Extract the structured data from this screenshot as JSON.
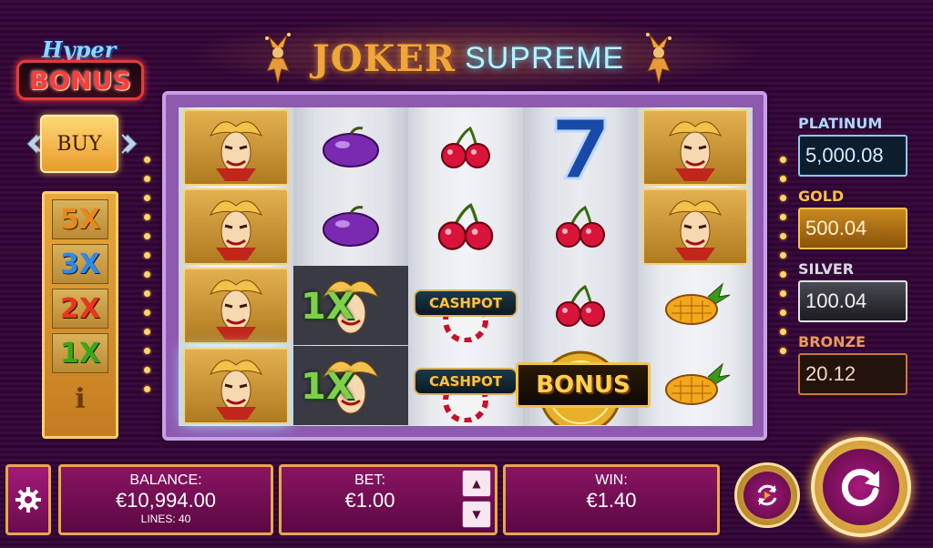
{
  "logo": {
    "part1": "JOKER",
    "part2": "SUPREME"
  },
  "hyper_bonus": {
    "line1": "Hyper",
    "line2": "BONUS"
  },
  "buy_label": "BUY",
  "multipliers": [
    {
      "label": "5X",
      "color": "#e88a1a"
    },
    {
      "label": "3X",
      "color": "#2f8ae8"
    },
    {
      "label": "2X",
      "color": "#e8381a"
    },
    {
      "label": "1X",
      "color": "#3aa81a"
    }
  ],
  "info_label": "i",
  "reels": [
    [
      "joker",
      "joker",
      "joker",
      "joker"
    ],
    [
      "plum",
      "plum",
      "joker-1x",
      "joker-1x"
    ],
    [
      "cherry",
      "cherry",
      "cashpot",
      "cashpot"
    ],
    [
      "seven",
      "cherry",
      "cherry",
      "bonus-coin"
    ],
    [
      "joker",
      "joker",
      "pineapple",
      "pineapple"
    ]
  ],
  "cashpot_label": "CASHPOT",
  "bonus_label": "BONUS",
  "mult_symbol_label": "1X",
  "jackpots": [
    {
      "label": "PLATINUM",
      "value": "5,000.08",
      "label_color": "#a9d8ff",
      "box_bg": "#0c1e2e",
      "box_border": "#8fc8f0",
      "text_color": "#d8ecff"
    },
    {
      "label": "GOLD",
      "value": "500.04",
      "label_color": "#f6c04a",
      "box_bg": "#a86a10",
      "box_border": "#f6c04a",
      "text_color": "#fff3d0"
    },
    {
      "label": "SILVER",
      "value": "100.04",
      "label_color": "#d8d8e0",
      "box_bg": "#2a2a30",
      "box_border": "#e0e0e8",
      "text_color": "#f0f0f4"
    },
    {
      "label": "BRONZE",
      "value": "20.12",
      "label_color": "#e89a5a",
      "box_bg": "#22140c",
      "box_border": "#c87a3a",
      "text_color": "#f0d8c0"
    }
  ],
  "balance": {
    "label": "BALANCE:",
    "value": "€10,994.00",
    "lines": "LINES: 40"
  },
  "bet": {
    "label": "BET:",
    "value": "€1.00"
  },
  "win": {
    "label": "WIN:",
    "value": "€1.40"
  },
  "icons": {
    "settings": "gear-icon",
    "autoplay": "autoplay-icon",
    "spin": "spin-icon",
    "bet_up": "triangle-up-icon",
    "bet_down": "triangle-down-icon"
  }
}
